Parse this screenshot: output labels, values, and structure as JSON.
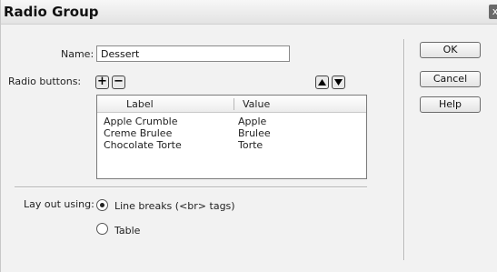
{
  "window": {
    "title": "Radio Group",
    "close_glyph": "x"
  },
  "form": {
    "name_label": "Name:",
    "name_value": "Dessert",
    "radio_buttons_label": "Radio buttons:",
    "add_glyph": "+",
    "remove_glyph": "−"
  },
  "list": {
    "columns": [
      "Label",
      "Value"
    ],
    "rows": [
      {
        "label": "Apple Crumble",
        "value": "Apple"
      },
      {
        "label": "Creme Brulee",
        "value": "Brulee"
      },
      {
        "label": "Chocolate Torte",
        "value": "Torte"
      }
    ]
  },
  "layout": {
    "label": "Lay out using:",
    "options": [
      {
        "label": "Line breaks (<br> tags)",
        "selected": true
      },
      {
        "label": "Table",
        "selected": false
      }
    ]
  },
  "buttons": {
    "ok": "OK",
    "cancel": "Cancel",
    "help": "Help"
  },
  "icons": [
    "add-icon",
    "remove-icon",
    "move-up-icon",
    "move-down-icon",
    "close-icon"
  ]
}
